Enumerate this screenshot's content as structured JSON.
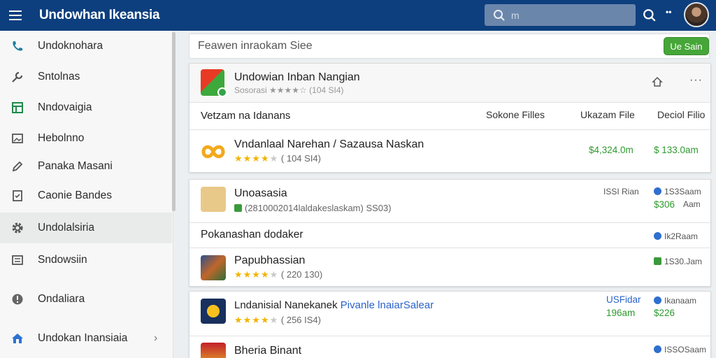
{
  "header": {
    "title": "Undowhan Ikeansia",
    "search_placeholder": "m",
    "more_label": "••",
    "colors": {
      "bar": "#0d3f7e",
      "accent_green": "#46a638"
    }
  },
  "sidebar": {
    "items": [
      {
        "label": "Undoknohara",
        "icon": "phone-icon"
      },
      {
        "label": "Sntolnas",
        "icon": "wrench-icon"
      },
      {
        "label": "Nndovaigia",
        "icon": "spreadsheet-icon"
      },
      {
        "label": "Hebolnno",
        "icon": "image-icon"
      },
      {
        "label": "Panaka Masani",
        "icon": "pencil-icon"
      },
      {
        "label": "Caonie Bandes",
        "icon": "document-icon"
      },
      {
        "label": "Undolalsiria",
        "icon": "gear-icon"
      },
      {
        "label": "Sndowsiin",
        "icon": "list-icon"
      },
      {
        "label": "Ondaliara",
        "icon": "info-icon"
      },
      {
        "label": "Undokan Inansiaia",
        "icon": "home-icon"
      }
    ]
  },
  "filter": {
    "placeholder": "Feawen inraokam Siee",
    "button_label": "Ue Sain"
  },
  "card1": {
    "top_app": {
      "name": "Undowian Inban Nangian",
      "rating_text": "Sosorasi ★★★★☆ (104 SI4)"
    },
    "columns": {
      "label": "Vetzam na Idanans",
      "c1": "Sokone Filles",
      "c2": "Ukazam File",
      "c3": "Deciol Filio"
    },
    "app": {
      "name": "Vndanlaal Narehan / Sazausa Naskan",
      "stars": 4,
      "count": "( 104 SI4)",
      "price1": "$4,324.0m",
      "price2": "$ 133.0am"
    }
  },
  "card2": {
    "app1": {
      "name": "Unoasasia",
      "subline": "(2810002014laldakeslaskam) SS03)",
      "meta1": "ISSI Rian",
      "meta2": "1S3Saam",
      "meta3": "$306",
      "meta4": "Aam"
    },
    "section": {
      "label": "Pokanashan dodaker",
      "meta": "Ik2Raam"
    },
    "app2": {
      "name": "Papubhassian",
      "stars": 4,
      "count": "( 220 130)",
      "meta": "1S30.Jam"
    }
  },
  "card3": {
    "app1": {
      "name_main": "Lndanisial Nanekanek",
      "name_accent": "Pivanle lnaiarSalear",
      "stars": 4,
      "count": "( 256 IS4)",
      "price1_blue": "USFidar",
      "price1": "196am",
      "meta1": "Ikanaam",
      "price2": "$226"
    },
    "app2": {
      "name": "Bheria Binant",
      "meta": "ISSOSaam"
    }
  }
}
